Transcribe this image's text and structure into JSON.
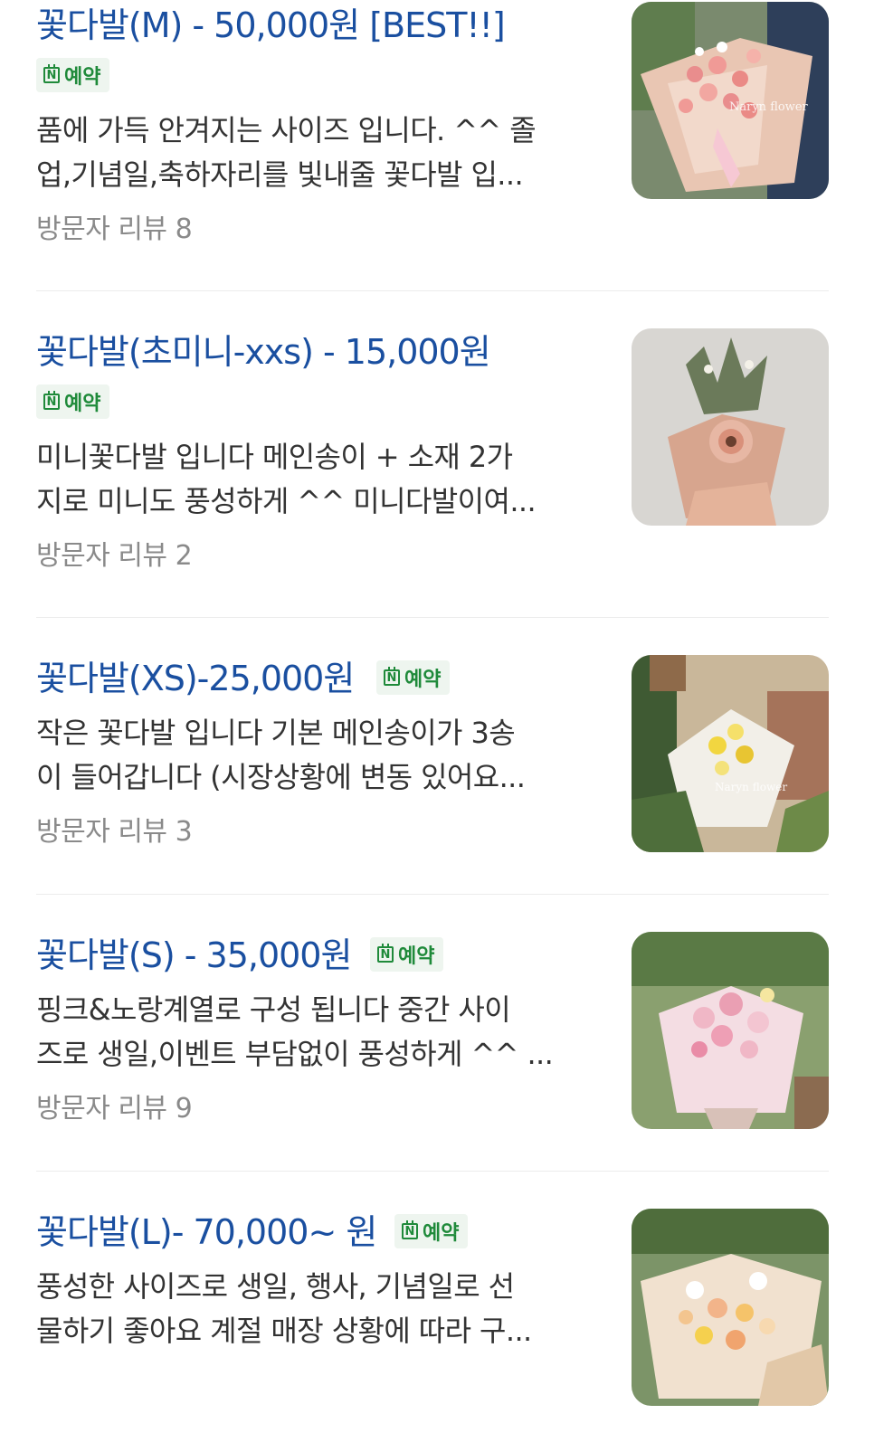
{
  "badge_label": "예약",
  "badge_icon": "calendar-naver-icon",
  "reviews_prefix": "방문자 리뷰",
  "items": [
    {
      "title": "꽃다발(M) - 50,000원 [BEST!!]",
      "desc_line1": "품에 가득 안겨지는 사이즈 입니다. ^^ 졸",
      "desc_line2": "업,기념일,축하자리를 빛내줄 꽃다발 입...",
      "reviews": "방문자 리뷰 8",
      "watermark": "Naryn flower"
    },
    {
      "title": "꽃다발(초미니-xxs) - 15,000원",
      "desc_line1": "미니꽃다발 입니다 메인송이 + 소재 2가",
      "desc_line2": "지로 미니도 풍성하게 ^^ 미니다발이여...",
      "reviews": "방문자 리뷰 2"
    },
    {
      "title": "꽃다발(XS)-25,000원",
      "desc_line1": "작은 꽃다발 입니다 기본 메인송이가 3송",
      "desc_line2": "이 들어갑니다 (시장상황에 변동 있어요...",
      "reviews": "방문자 리뷰 3",
      "watermark": "Naryn flower"
    },
    {
      "title": "꽃다발(S) - 35,000원",
      "desc_line1": "핑크&노랑계열로 구성 됩니다 중간 사이",
      "desc_line2": "즈로 생일,이벤트 부담없이 풍성하게 ^^ ...",
      "reviews": "방문자 리뷰 9"
    },
    {
      "title": "꽃다발(L)- 70,000~ 원",
      "desc_line1": "풍성한 사이즈로 생일, 행사, 기념일로 선",
      "desc_line2": "물하기 좋아요 계절 매장 상황에 따라 구..."
    }
  ],
  "colors": {
    "title": "#1a4fa0",
    "badge_text": "#1f8a3a",
    "badge_bg": "#eef5ef",
    "desc": "#333333",
    "reviews": "#8a8a8a",
    "divider": "#ececec"
  }
}
